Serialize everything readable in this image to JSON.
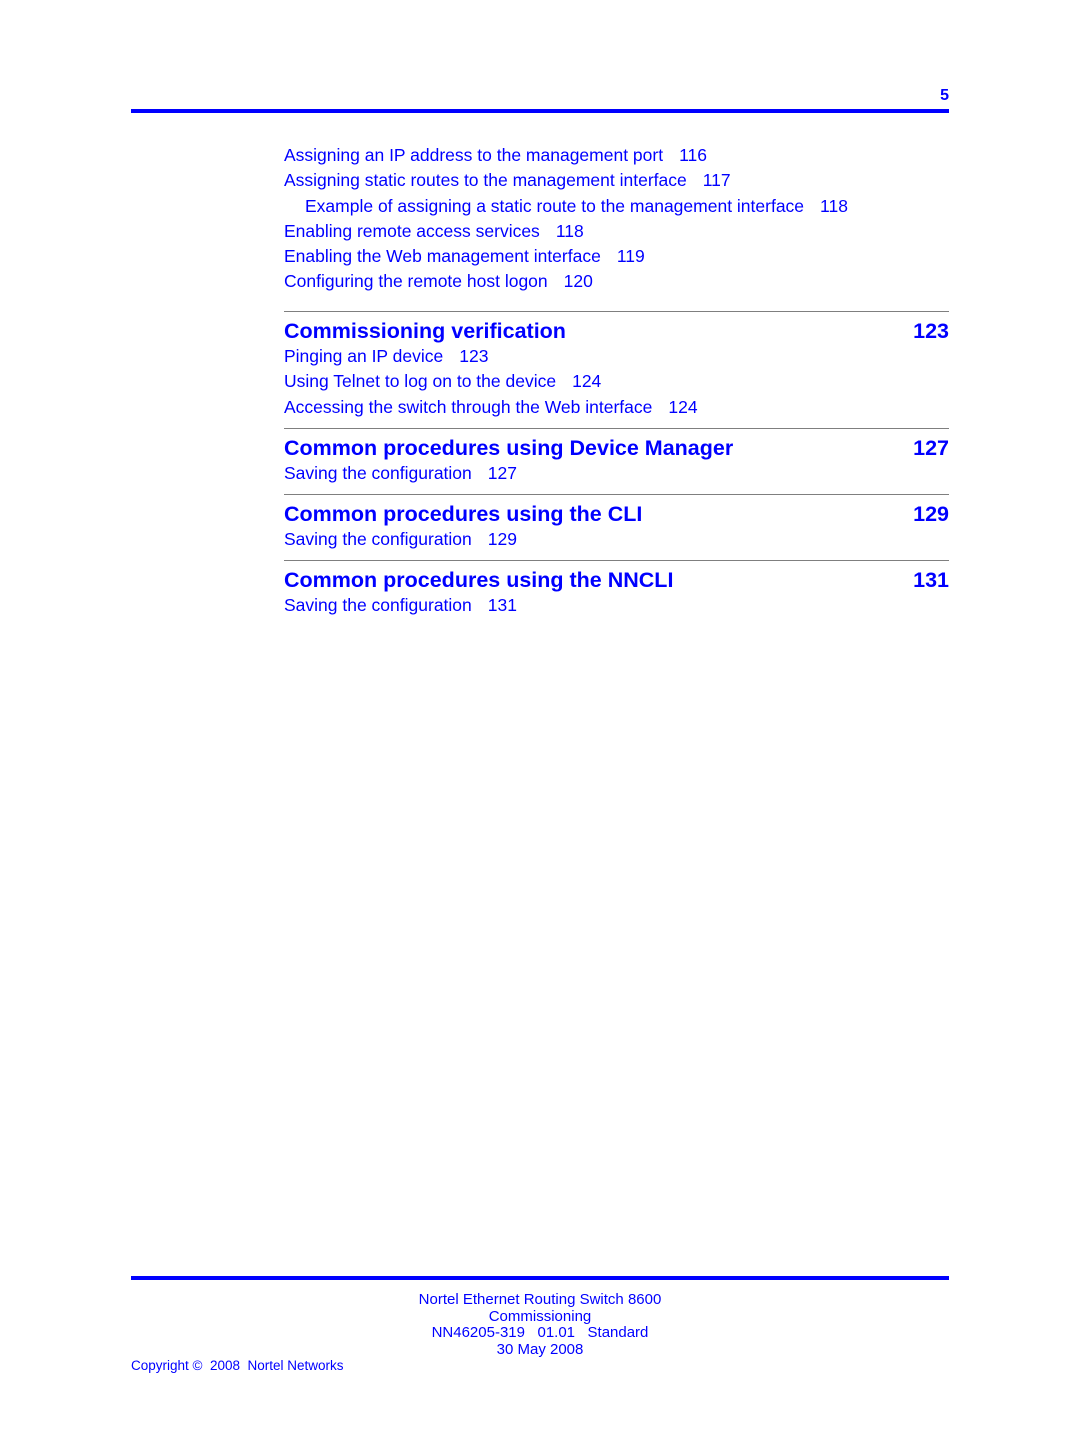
{
  "header": {
    "page_number": "5"
  },
  "toc": {
    "lead_entries": [
      {
        "title": "Assigning an IP address to the management port",
        "page": "116",
        "level": 1
      },
      {
        "title": "Assigning static routes to the management interface",
        "page": "117",
        "level": 1
      },
      {
        "title": "Example of assigning a static route to the management interface",
        "page": "118",
        "level": 2
      },
      {
        "title": "Enabling remote access services",
        "page": "118",
        "level": 1
      },
      {
        "title": "Enabling the Web management interface",
        "page": "119",
        "level": 1
      },
      {
        "title": "Configuring the remote host logon",
        "page": "120",
        "level": 1
      }
    ],
    "chapters": [
      {
        "title": "Commissioning verification",
        "page": "123",
        "entries": [
          {
            "title": "Pinging an IP device",
            "page": "123"
          },
          {
            "title": "Using Telnet to log on to the device",
            "page": "124"
          },
          {
            "title": "Accessing the switch through the Web interface",
            "page": "124"
          }
        ]
      },
      {
        "title": "Common procedures using Device Manager",
        "page": "127",
        "entries": [
          {
            "title": "Saving the configuration",
            "page": "127"
          }
        ]
      },
      {
        "title": "Common procedures using the CLI",
        "page": "129",
        "entries": [
          {
            "title": "Saving the configuration",
            "page": "129"
          }
        ]
      },
      {
        "title": "Common procedures using the NNCLI",
        "page": "131",
        "entries": [
          {
            "title": "Saving the configuration",
            "page": "131"
          }
        ]
      }
    ]
  },
  "footer": {
    "line1": "Nortel Ethernet Routing Switch 8600",
    "line2": "Commissioning",
    "line3": "NN46205-319   01.01   Standard",
    "line4": "30 May 2008",
    "copyright": "Copyright ©  2008  Nortel Networks"
  },
  "colors": {
    "text": "#0000ff",
    "rule": "#0000ff",
    "divider": "#7f7f7f"
  }
}
